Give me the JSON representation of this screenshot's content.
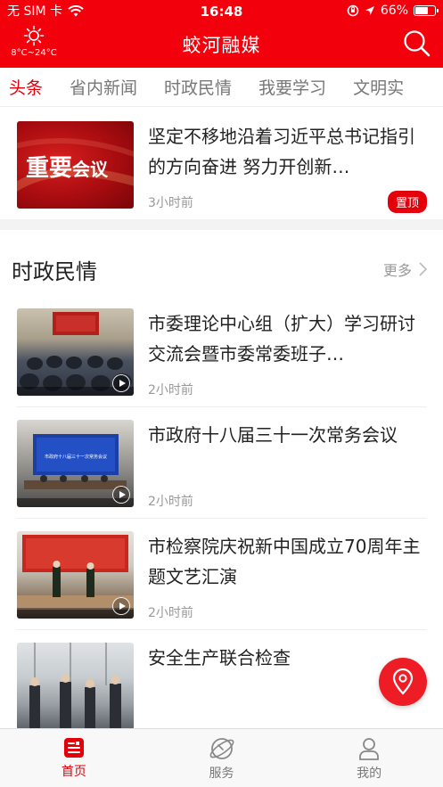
{
  "status_bar": {
    "carrier": "无 SIM 卡",
    "time": "16:48",
    "battery": "66%",
    "battery_level": 0.66,
    "icons": [
      "wifi-icon",
      "orientation-lock-icon",
      "location-arrow-icon",
      "battery-icon"
    ]
  },
  "header": {
    "title": "蛟河融媒",
    "weather_temp": "8°C~24°C",
    "weather_icon": "sun-icon",
    "search_icon": "search-icon"
  },
  "tabs": [
    {
      "label": "头条",
      "active": true
    },
    {
      "label": "省内新闻",
      "active": false
    },
    {
      "label": "时政民情",
      "active": false
    },
    {
      "label": "我要学习",
      "active": false
    },
    {
      "label": "文明实",
      "active": false
    }
  ],
  "top_story": {
    "title": "坚定不移地沿着习近平总书记指引的方向奋进 努力开创新…",
    "time": "3小时前",
    "badge": "置顶",
    "thumb_text_big": "重要",
    "thumb_text_small": "会议"
  },
  "section": {
    "title": "时政民情",
    "more_label": "更多",
    "more_icon": "chevron-right-icon"
  },
  "items": [
    {
      "title": "市委理论中心组（扩大）学习研讨交流会暨市委常委班子…",
      "time": "2小时前",
      "video": true,
      "banner_text": ""
    },
    {
      "title": "市政府十八届三十一次常务会议",
      "time": "2小时前",
      "video": true,
      "banner_text": "市政府十八届三十一次常务会议"
    },
    {
      "title": "市检察院庆祝新中国成立70周年主题文艺汇演",
      "time": "2小时前",
      "video": true,
      "banner_text": ""
    },
    {
      "title": "安全生产联合检查",
      "time": "",
      "video": false,
      "banner_text": ""
    }
  ],
  "fab": {
    "icon": "location-pin-icon"
  },
  "bottom_nav": [
    {
      "label": "首页",
      "icon": "home-news-icon",
      "active": true
    },
    {
      "label": "服务",
      "icon": "planet-service-icon",
      "active": false
    },
    {
      "label": "我的",
      "icon": "user-icon",
      "active": false
    }
  ],
  "colors": {
    "brand": "#f2000b",
    "accent": "#e3000b",
    "muted": "#999999"
  }
}
